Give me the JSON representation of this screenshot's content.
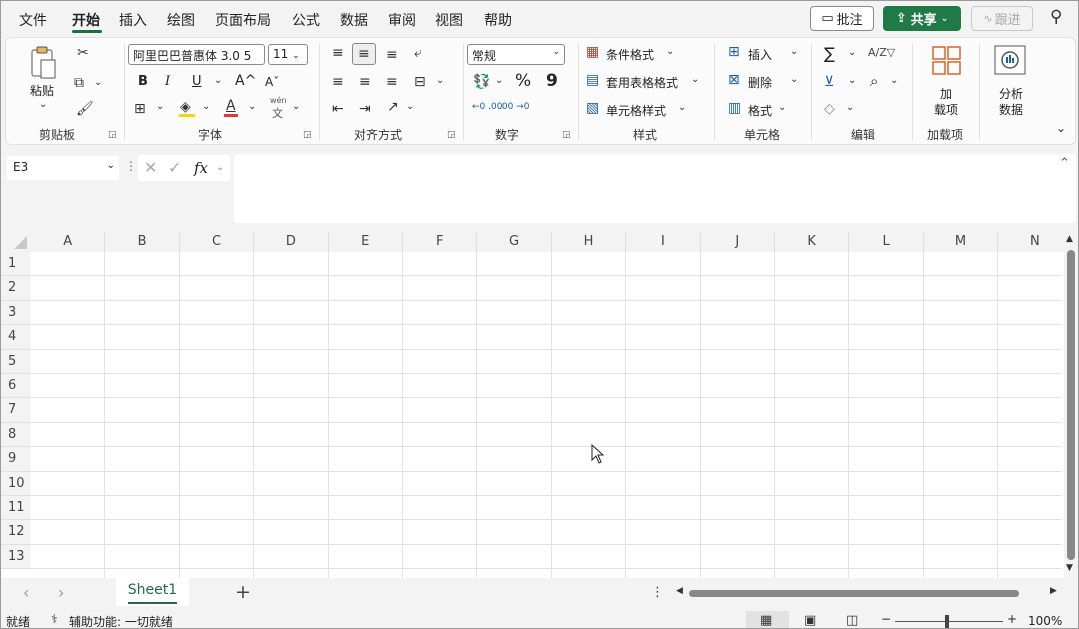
{
  "menu": {
    "items": [
      {
        "label": "文件"
      },
      {
        "label": "开始"
      },
      {
        "label": "插入"
      },
      {
        "label": "绘图"
      },
      {
        "label": "页面布局"
      },
      {
        "label": "公式"
      },
      {
        "label": "数据"
      },
      {
        "label": "审阅"
      },
      {
        "label": "视图"
      },
      {
        "label": "帮助"
      }
    ],
    "active": "开始",
    "comment_label": "批注",
    "share_label": "共享",
    "track_label": "跟进"
  },
  "ribbon": {
    "clipboard": {
      "paste_label": "粘贴",
      "group_label": "剪贴板"
    },
    "font": {
      "font_name": "阿里巴巴普惠体 3.0 5",
      "font_size": "11",
      "bold": "B",
      "italic": "I",
      "underline": "U",
      "grow": "A^",
      "shrink": "Aˇ",
      "wen": "wén",
      "wen_char": "文",
      "group_label": "字体"
    },
    "alignment": {
      "group_label": "对齐方式"
    },
    "number": {
      "format": "常规",
      "percent": "%",
      "comma": "9",
      "inc": "←0 .00",
      "dec": ".00 →0",
      "group_label": "数字"
    },
    "styles": {
      "conditional": "条件格式",
      "table": "套用表格格式",
      "cell": "单元格样式",
      "group_label": "样式"
    },
    "cells": {
      "insert": "插入",
      "delete": "删除",
      "format": "格式",
      "group_label": "单元格"
    },
    "editing": {
      "sum": "∑",
      "sort": "A/Z▽",
      "find": "⌕",
      "group_label": "编辑"
    },
    "addins": {
      "label_line1": "加",
      "label_line2": "载项",
      "group_label": "加载项"
    },
    "analyze": {
      "label_line1": "分析",
      "label_line2": "数据"
    }
  },
  "formula_bar": {
    "name_box": "E3",
    "fx": "fx",
    "value": ""
  },
  "grid": {
    "columns": [
      "A",
      "B",
      "C",
      "D",
      "E",
      "F",
      "G",
      "H",
      "I",
      "J",
      "K",
      "L",
      "M",
      "N"
    ],
    "rows": [
      "1",
      "2",
      "3",
      "4",
      "5",
      "6",
      "7",
      "8",
      "9",
      "10",
      "11",
      "12",
      "13"
    ]
  },
  "sheets": {
    "tabs": [
      {
        "label": "Sheet1"
      }
    ],
    "add": "+"
  },
  "status": {
    "ready": "就绪",
    "accessibility": "辅助功能: 一切就绪",
    "zoom": "100%",
    "zoom_minus": "−",
    "zoom_plus": "+"
  },
  "colors": {
    "accent": "#1f7a45",
    "tab_underline": "#1d6f42"
  }
}
